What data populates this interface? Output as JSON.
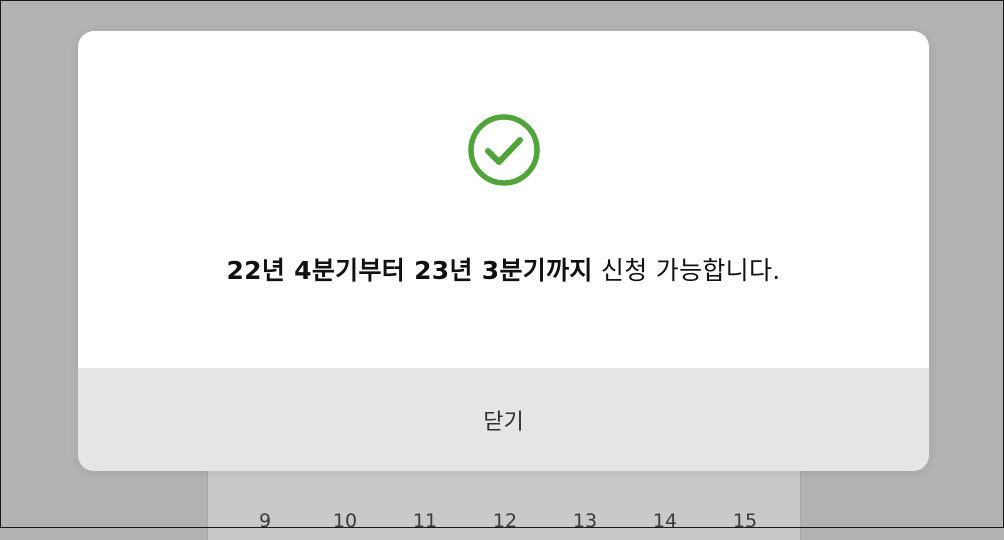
{
  "modal": {
    "icon": "check-circle-icon",
    "message_bold": "22년 4분기부터 23년 3분기까지",
    "message_rest": " 신청 가능합니다.",
    "close_label": "닫기"
  },
  "background": {
    "calendar_days": [
      "9",
      "10",
      "11",
      "12",
      "13",
      "14",
      "15"
    ]
  },
  "colors": {
    "overlay": "#b2b2b2",
    "success_green": "#4fa43a",
    "footer_bg": "#e5e5e5"
  }
}
